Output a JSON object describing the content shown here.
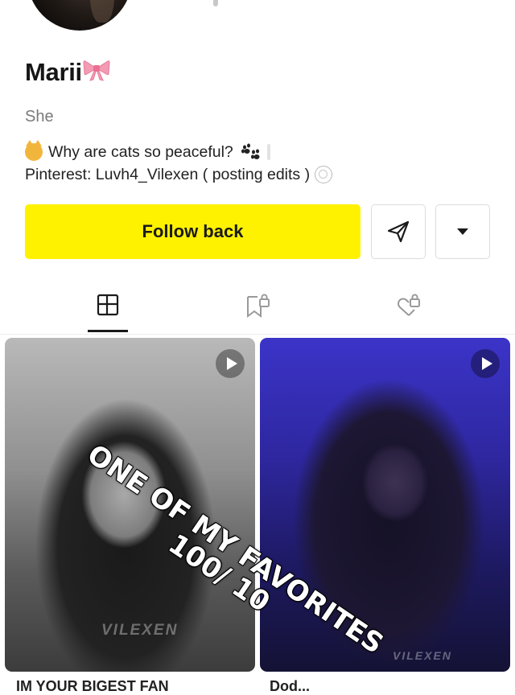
{
  "profile": {
    "name": "Marii",
    "name_emoji": "bow-icon",
    "pronouns": "She",
    "bio_line1": "Why are cats so peaceful?",
    "bio_line2": "Pinterest: Luvh4_Vilexen ( posting edits )"
  },
  "actions": {
    "follow_back_label": "Follow back",
    "send_icon": "send-icon",
    "more_icon": "caret-down-icon"
  },
  "tabs": [
    {
      "icon": "grid-icon",
      "active": true
    },
    {
      "icon": "saved-locked-icon",
      "active": false
    },
    {
      "icon": "liked-locked-icon",
      "active": false
    }
  ],
  "videos": [
    {
      "watermark": "VILEXEN",
      "caption": "IM YOUR BIGEST FAN"
    },
    {
      "watermark": "VILEXEN",
      "caption": "Dod..."
    }
  ],
  "overlay_text": "ONE OF MY FAVORITES 100/ 10",
  "colors": {
    "follow_button": "#fff200",
    "text_primary": "#161616",
    "text_secondary": "#7a7a7a"
  }
}
